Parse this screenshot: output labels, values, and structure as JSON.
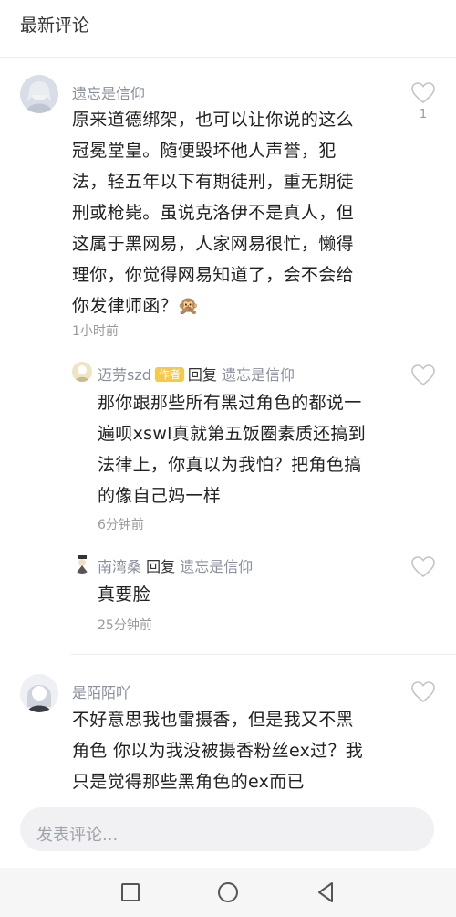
{
  "header": {
    "title": "最新评论"
  },
  "comments": [
    {
      "user": "遗忘是信仰",
      "text_lines": [
        "原来道德绑架，也可以让你说的这么",
        "冠冕堂皇。随便毁坏他人声誉，犯",
        "法，轻五年以下有期徒刑，重无期徒",
        "刑或枪毙。虽说克洛伊不是真人，但",
        "这属于黑网易，人家网易很忙，懒得",
        "理你，你觉得网易知道了，会不会给",
        "你发律师函？🙊"
      ],
      "time": "1小时前",
      "likes": "1",
      "replies": [
        {
          "user": "迈劳szd",
          "badge": "作者",
          "reply_word": "回复",
          "reply_to": "遗忘是信仰",
          "text_lines": [
            "那你跟那些所有黑过角色的都说一",
            "遍呗xswl真就第五饭圈素质还搞到",
            "法律上，你真以为我怕？把角色搞",
            "的像自己妈一样"
          ],
          "time": "6分钟前"
        },
        {
          "user": "南湾桑",
          "reply_word": "回复",
          "reply_to": "遗忘是信仰",
          "text_lines": [
            "真要脸"
          ],
          "time": "25分钟前"
        }
      ]
    },
    {
      "user": "是陌陌吖",
      "text_lines": [
        "不好意思我也雷摄香，但是我又不黑",
        "角色 你以为我没被摄香粉丝ex过？我",
        "只是觉得那些黑角色的ex而已"
      ]
    }
  ],
  "composer": {
    "placeholder": "发表评论..."
  },
  "icons": {
    "like": "heart-outline-icon",
    "nav_recent": "square-icon",
    "nav_home": "circle-icon",
    "nav_back": "triangle-back-icon",
    "emoji": "see-no-evil-monkey-icon"
  },
  "colors": {
    "name": "#8a8f9c",
    "badge": "#f7c948",
    "composer_bg": "#f1f1f3"
  }
}
